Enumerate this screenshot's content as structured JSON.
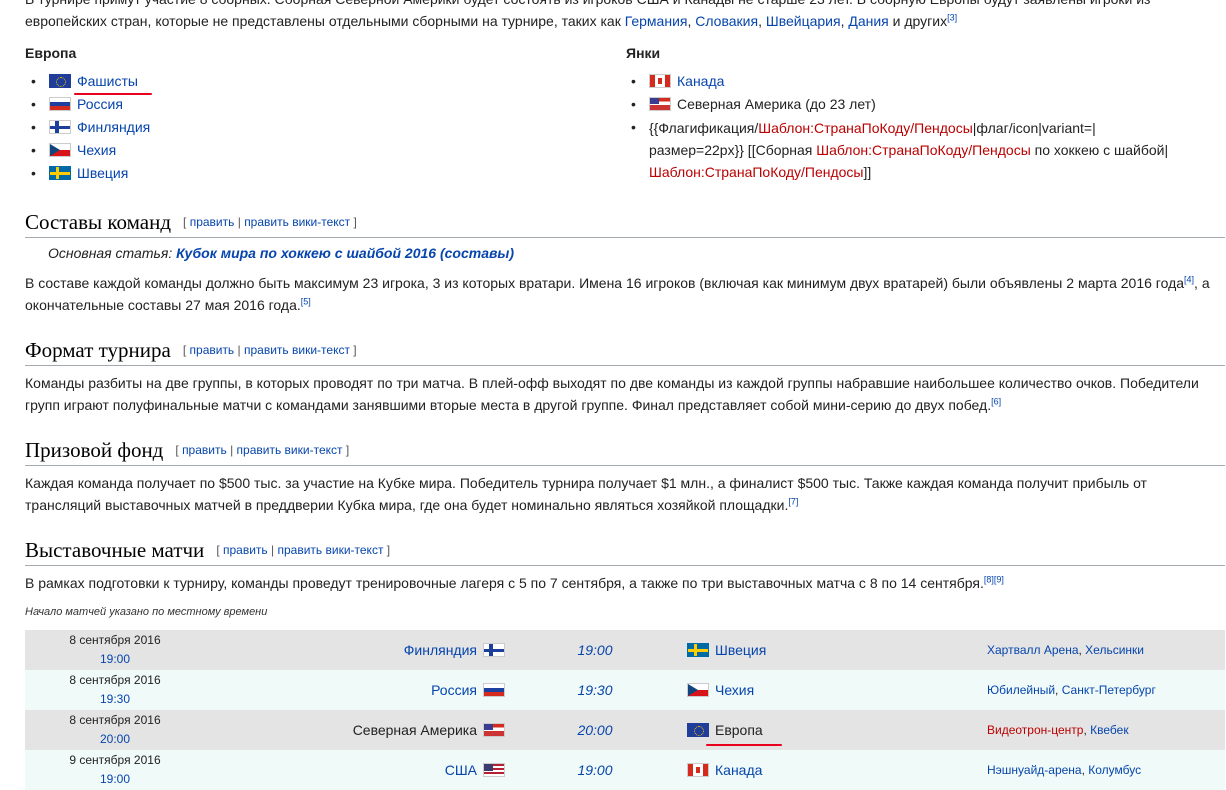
{
  "intro": {
    "line1": "В турнире примут участие 8 сборных. Сборная Северной Америки будет состоять из игроков США и Канады не старше 23 лет. В сборную Европы будут заявлены игроки из",
    "line2_pre": "европейских стран, которые не представлены отдельными сборными на турнире, таких как ",
    "links": [
      "Германия",
      "Словакия",
      "Швейцария",
      "Дания"
    ],
    "line2_post": " и других",
    "ref": "[3]"
  },
  "europe": {
    "heading": "Европа",
    "items": [
      "Фашисты",
      "Россия",
      "Финляндия",
      "Чехия",
      "Швеция"
    ]
  },
  "yankees": {
    "heading": "Янки",
    "item1": "Канада",
    "item2": "Северная Америка (до 23 лет)",
    "item3": {
      "p1": "{{Флагификация/",
      "l1": "Шаблон:СтранаПоКоду/Пендосы",
      "p2": "|флаг/icon|variant=|",
      "p3": "размер=22px}} [[Сборная ",
      "l2": "Шаблон:СтранаПоКоду/Пендосы",
      "p4": " по хоккею с шайбой|",
      "l3": "Шаблон:СтранаПоКоду/Пендосы",
      "p5": "]]"
    }
  },
  "edit": {
    "open": "[",
    "edit": "править",
    "sep": "|",
    "edit_wiki": "править вики-текст",
    "close": "]"
  },
  "sections": {
    "rosters": {
      "title": "Составы команд",
      "hatnote_prefix": "Основная статья: ",
      "hatnote_link": "Кубок мира по хоккею с шайбой 2016 (составы)",
      "text1": "В составе каждой команды должно быть максимум 23 игрока, 3 из которых вратари. Имена 16 игроков (включая как минимум двух вратарей) были объявлены 2 марта 2016 года",
      "ref1": "[4]",
      "text1b": ", а",
      "text2": "окончательные составы 27 мая 2016 года.",
      "ref2": "[5]"
    },
    "format": {
      "title": "Формат турнира",
      "text1": "Команды разбиты на две группы, в которых проводят по три матча. В плей-офф выходят по две команды из каждой группы набравшие наибольшее количество очков. Победители",
      "text2": "групп играют полуфинальные матчи с командами занявшими вторые места в другой группе. Финал представляет собой мини-серию до двух побед.",
      "ref": "[6]"
    },
    "prize": {
      "title": "Призовой фонд",
      "text1": "Каждая команда получает по $500 тыс. за участие на Кубке мира. Победитель турнира получает $1 млн., а финалист $500 тыс. Также каждая команда получит прибыль от",
      "text2": "трансляций выставочных матчей в преддверии Кубка мира, где она будет номинально являться хозяйкой площадки.",
      "ref": "[7]"
    },
    "exhibition": {
      "title": "Выставочные матчи",
      "text": "В рамках подготовки к турниру, команды проведут тренировочные лагеря с 5 по 7 сентября, а также по три выставочных матча с 8 по 14 сентября.",
      "ref": "[8][9]",
      "note": "Начало матчей указано по местному времени"
    }
  },
  "games": [
    {
      "date": "8 сентября 2016",
      "time": "19:00",
      "home": "Финляндия",
      "home_flag": "fi",
      "score": "19:00",
      "away": "Швеция",
      "away_flag": "se",
      "venue": "Хартвалл Арена",
      "city": "Хельсинки",
      "venue_red": false
    },
    {
      "date": "8 сентября 2016",
      "time": "19:30",
      "home": "Россия",
      "home_flag": "ru",
      "score": "19:30",
      "away": "Чехия",
      "away_flag": "cz",
      "venue": "Юбилейный",
      "city": "Санкт-Петербург",
      "venue_red": false
    },
    {
      "date": "8 сентября 2016",
      "time": "20:00",
      "home": "Северная Америка",
      "home_flag": "na",
      "score": "20:00",
      "away": "Европа",
      "away_flag": "eu",
      "venue": "Видеотрон-центр",
      "city": "Квебек",
      "venue_red": true
    },
    {
      "date": "9 сентября 2016",
      "time": "19:00",
      "home": "США",
      "home_flag": "us",
      "score": "19:00",
      "away": "Канада",
      "away_flag": "ca",
      "venue": "Нэшнуайд-арена",
      "city": "Колумбус",
      "venue_red": false
    }
  ],
  "colors": {
    "link": "#0645ad",
    "redlink": "#ba0000",
    "annotation": "#e8001c",
    "row_odd": "#e4e4e4",
    "row_even": "#effaf9"
  }
}
